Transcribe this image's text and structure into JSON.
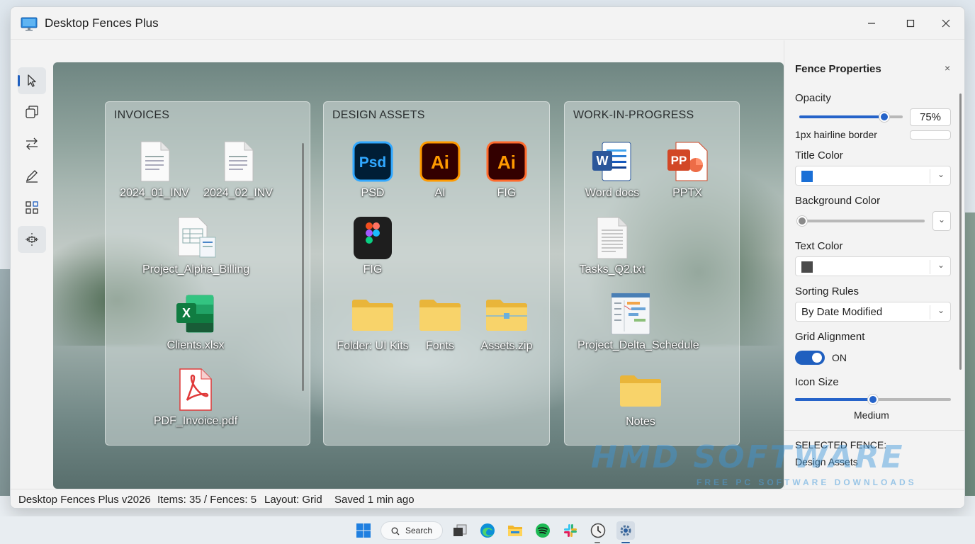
{
  "window": {
    "title": "Desktop Fences Plus",
    "controls": {
      "minimize": "—",
      "maximize": "☐",
      "close": "✕"
    }
  },
  "toolbar": {
    "tools": [
      {
        "icon": "pointer-icon",
        "active": true
      },
      {
        "icon": "copy-icon"
      },
      {
        "icon": "swap-arrows-icon"
      },
      {
        "icon": "pen-icon"
      },
      {
        "icon": "grid-arrange-icon"
      },
      {
        "icon": "spacing-icon"
      }
    ]
  },
  "fences": [
    {
      "title": "INVOICES",
      "items": [
        {
          "label": "2024_01_INV",
          "icon": "document-icon"
        },
        {
          "label": "2024_02_INV",
          "icon": "document-icon"
        },
        {
          "label": "Project_Alpha_Billing",
          "icon": "spreadsheet-doc-icon"
        },
        {
          "label": "Clients.xlsx",
          "icon": "excel-icon"
        },
        {
          "label": "PDF_Invoice.pdf",
          "icon": "pdf-icon"
        }
      ]
    },
    {
      "title": "DESIGN ASSETS",
      "items": [
        {
          "label": "PSD",
          "icon": "photoshop-icon",
          "badge": "Psd"
        },
        {
          "label": "AI",
          "icon": "illustrator-icon",
          "badge": "Ai"
        },
        {
          "label": "FIG",
          "icon": "illustrator-icon",
          "badge": "Ai"
        },
        {
          "label": "FIG",
          "icon": "figma-icon"
        },
        {
          "label": "Folder: UI Kits",
          "icon": "folder-icon"
        },
        {
          "label": "Fonts",
          "icon": "folder-icon"
        },
        {
          "label": "Assets.zip",
          "icon": "zip-folder-icon"
        }
      ]
    },
    {
      "title": "WORK-IN-PROGRESS",
      "items": [
        {
          "label": "Word docs",
          "icon": "word-icon",
          "badge": "W"
        },
        {
          "label": "PPTX",
          "icon": "powerpoint-icon",
          "badge": "P"
        },
        {
          "label": "Tasks_Q2.txt",
          "icon": "text-file-icon"
        },
        {
          "label": "Project_Delta_Schedule",
          "icon": "schedule-doc-icon"
        },
        {
          "label": "Notes",
          "icon": "folder-icon"
        }
      ]
    }
  ],
  "properties": {
    "title": "Fence Properties",
    "close": "×",
    "opacity_label": "Opacity",
    "opacity_value": "75%",
    "opacity_level": 0.82,
    "border_label": "1px hairline border",
    "title_color_label": "Title Color",
    "title_color": "#1a6fd6",
    "background_color_label": "Background Color",
    "background_level": 0.0,
    "text_color_label": "Text Color",
    "text_color": "#4a4a4a",
    "sorting_label": "Sorting Rules",
    "sorting_value": "By Date Modified",
    "grid_label": "Grid Alignment",
    "grid_state": "ON",
    "icon_size_label": "Icon Size",
    "icon_size_value": "Medium",
    "icon_size_level": 0.5,
    "selected_label": "SELECTED FENCE:",
    "selected_value": "Design Assets"
  },
  "watermark": {
    "brand": "HMD SOFTWARE",
    "tagline": "FREE PC SOFTWARE DOWNLOADS"
  },
  "status": {
    "version": "Desktop Fences Plus v2026",
    "items": "Items: 35 / Fences: 5",
    "layout": "Layout: Grid",
    "saved": "Saved 1 min ago"
  },
  "taskbar": {
    "search_label": "Search",
    "icons": [
      "windows-start-icon",
      "task-view-icon",
      "edge-icon",
      "file-explorer-icon",
      "spotify-icon",
      "slack-icon",
      "clock-app-icon",
      "settings-app-icon"
    ]
  },
  "colors": {
    "accent": "#1f5fbf",
    "photoshop": "#31a8ff",
    "illustrator": "#ff9a00",
    "word": "#2b579a",
    "powerpoint": "#d24726",
    "excel": "#217346",
    "pdf": "#e03a3a",
    "folder": "#f6c94e"
  }
}
